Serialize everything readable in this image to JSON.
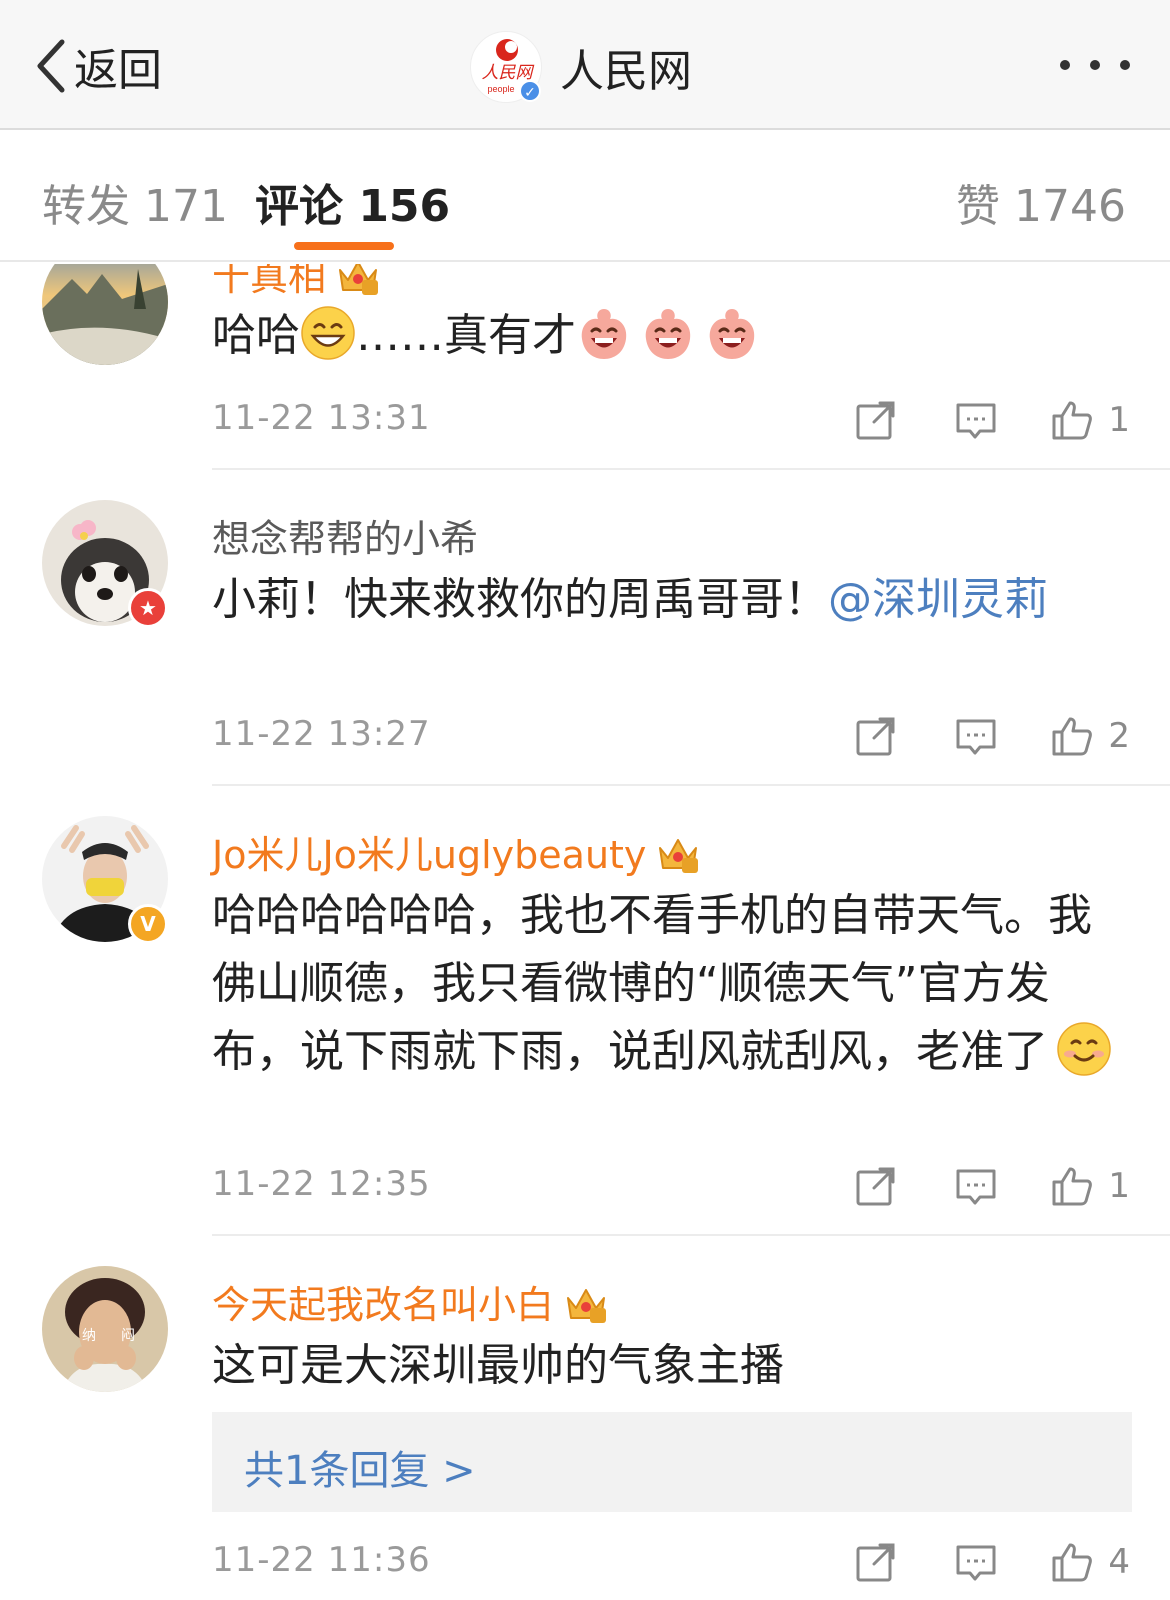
{
  "navbar": {
    "back_label": "返回",
    "title": "人民网",
    "logo_text": "人民网",
    "logo_sub": "people"
  },
  "tabs": {
    "repost": "转发 171",
    "comment": "评论 156",
    "like": "赞 1746"
  },
  "colors": {
    "accent": "#f7701a",
    "username_vip": "#f27a1e",
    "mention": "#4d7fbf",
    "verified": "#4a8fe7"
  },
  "comments": [
    {
      "username": "十真相",
      "crown_level": "5",
      "text": "哈哈",
      "text_mid": "……真有才",
      "time": "11-22 13:31",
      "likes": "1"
    },
    {
      "username": "想念帮帮的小希",
      "text": "小莉！快来救救你的周禹哥哥！",
      "mention": "@深圳灵莉",
      "time": "11-22 13:27",
      "likes": "2"
    },
    {
      "username": "Jo米儿Jo米儿uglybeauty",
      "crown_level": "7",
      "text": "哈哈哈哈哈哈，我也不看手机的自带天气。我佛山顺德，我只看微博的“顺德天气”官方发布，说下雨就下雨，说刮风就刮风，老准了",
      "time": "11-22 12:35",
      "likes": "1"
    },
    {
      "username": "今天起我改名叫小白",
      "crown_level": "5",
      "text": "这可是大深圳最帅的气象主播",
      "reply_summary": "共1条回复 >",
      "avatar_caption_left": "纳",
      "avatar_caption_right": "闷",
      "time": "11-22 11:36",
      "likes": "4"
    }
  ],
  "icons": {
    "share": "share-icon",
    "comment": "comment-icon",
    "like": "thumbs-up-icon"
  }
}
